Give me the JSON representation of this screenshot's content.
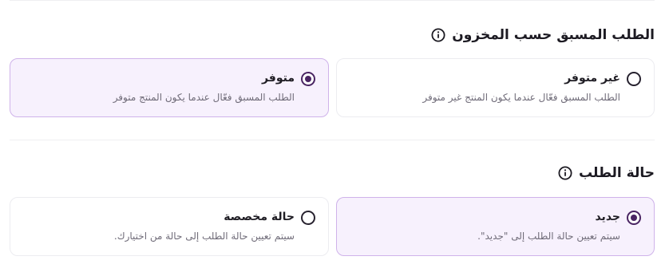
{
  "preorder_section": {
    "title": "الطلب المسبق حسب المخزون",
    "info_icon": "info-icon",
    "options": [
      {
        "label": "غير متوفر",
        "description": "الطلب المسبق فعّال عندما يكون المنتج غير متوفر",
        "selected": false
      },
      {
        "label": "متوفر",
        "description": "الطلب المسبق فعّال عندما يكون المنتج متوفر",
        "selected": true
      }
    ]
  },
  "order_status_section": {
    "title": "حالة الطلب",
    "info_icon": "info-icon",
    "options": [
      {
        "label": "جديد",
        "description": "سيتم تعيين حالة الطلب إلى \"جديد\".",
        "selected": true
      },
      {
        "label": "حالة مخصصة",
        "description": "سيتم تعيين حالة الطلب إلى حالة من اختيارك.",
        "selected": false
      }
    ]
  },
  "colors": {
    "accent": "#4a2563",
    "selected_background": "#f7f1fd",
    "selected_border": "#cfb3ea"
  }
}
